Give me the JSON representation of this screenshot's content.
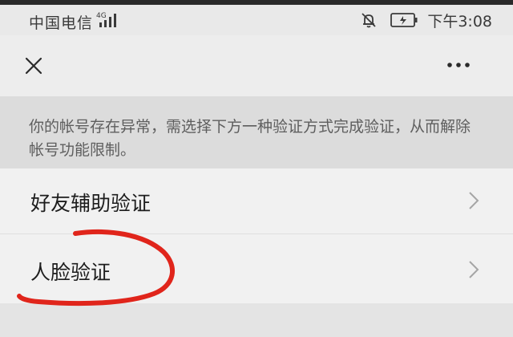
{
  "status_bar": {
    "carrier": "中国电信",
    "network": "4G",
    "time": "下午3:08"
  },
  "header": {
    "close_icon": "close-icon",
    "more_icon": "more-icon"
  },
  "notice": {
    "text": "你的帐号存在异常，需选择下方一种验证方式完成验证，从而解除帐号功能限制。"
  },
  "options": [
    {
      "label": "好友辅助验证",
      "icon": "chevron-right-icon"
    },
    {
      "label": "人脸验证",
      "icon": "chevron-right-icon"
    }
  ],
  "annotation": {
    "color": "#e0251b",
    "marks": "options.1"
  },
  "colors": {
    "notice_bg": "#dcdcdc",
    "list_bg": "#f1f1f1",
    "text_primary": "#1d1d1d",
    "text_secondary": "#5e5e5e"
  }
}
